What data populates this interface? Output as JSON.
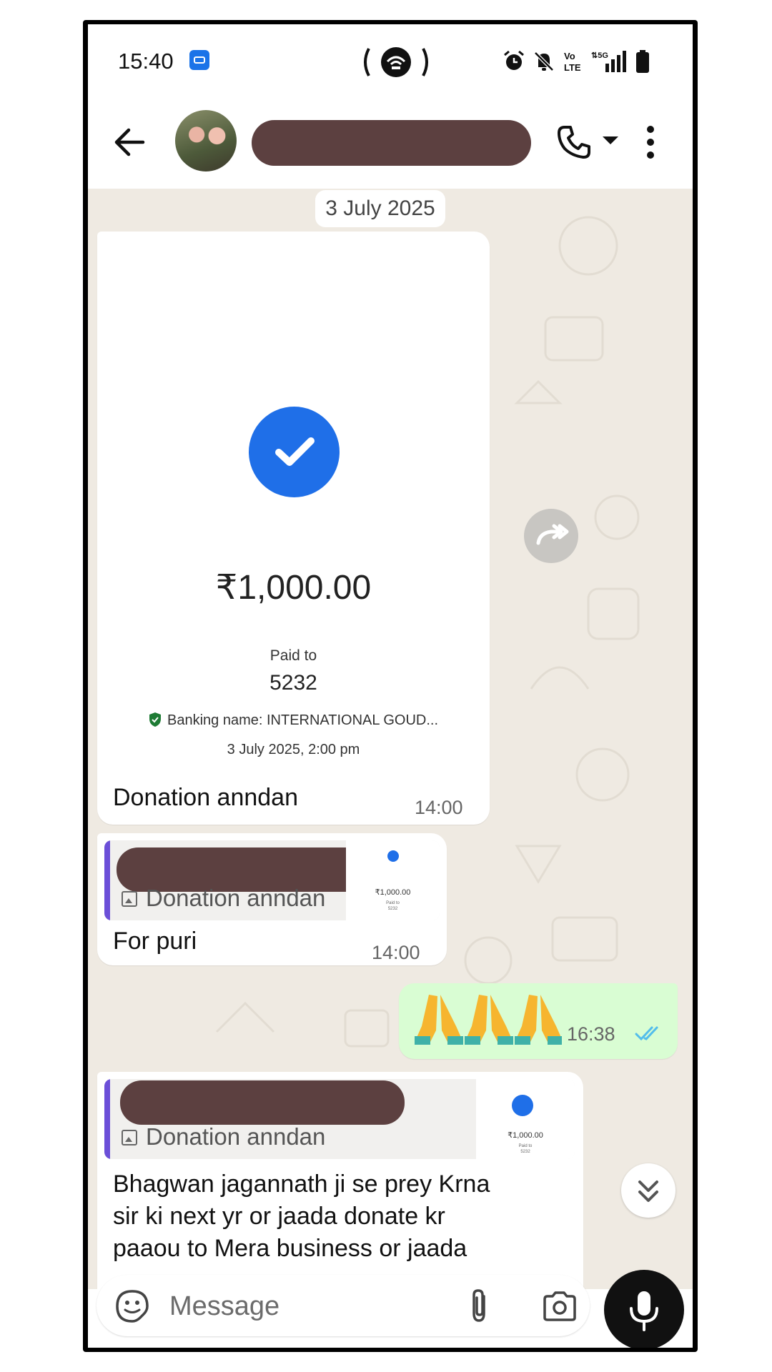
{
  "status_bar": {
    "time": "15:40",
    "icons": [
      "gallery-notification-icon",
      "hotspot-icon",
      "alarm-icon",
      "mute-icon",
      "volte-icon",
      "5g-signal-icon",
      "battery-icon"
    ]
  },
  "header": {
    "contact_name": "",
    "icons": [
      "back-arrow-icon",
      "phone-icon",
      "caret-down-icon",
      "more-vertical-icon"
    ]
  },
  "chat": {
    "date_pill": "3 July 2025",
    "messages": [
      {
        "type": "payment_screenshot",
        "amount": "₹1,000.00",
        "paid_to_label": "Paid to",
        "payee": "5232",
        "banking_name": "Banking name: INTERNATIONAL GOUD...",
        "payment_datetime": "3 July 2025, 2:00 pm",
        "caption": "Donation anndan",
        "time": "14:00"
      },
      {
        "type": "reply",
        "quoted_sender": "",
        "quoted_text": "Donation anndan",
        "thumb_amount": "₹1,000.00",
        "thumb_small": "Paid to",
        "thumb_payee": "5232",
        "text": "For puri",
        "time": "14:00"
      },
      {
        "type": "outgoing",
        "text": "🙏🙏🙏",
        "time": "16:38",
        "read": true
      },
      {
        "type": "reply",
        "quoted_sender": "",
        "quoted_text": "Donation anndan",
        "thumb_amount": "₹1,000.00",
        "thumb_small": "Paid to",
        "thumb_payee": "5232",
        "text_lines": [
          "Bhagwan jagannath ji se prey Krna",
          "sir ki next yr or jaada donate kr",
          "paaou to Mera business or jaada"
        ]
      }
    ]
  },
  "input": {
    "placeholder": "Message",
    "value": ""
  },
  "colors": {
    "accent_blue": "#1f6fe8",
    "outgoing_bubble": "#d9fdd3",
    "chat_background": "#efeae2",
    "redaction": "#5c4040",
    "quote_bar": "#6b4fd8",
    "read_ticks": "#53bdeb"
  }
}
